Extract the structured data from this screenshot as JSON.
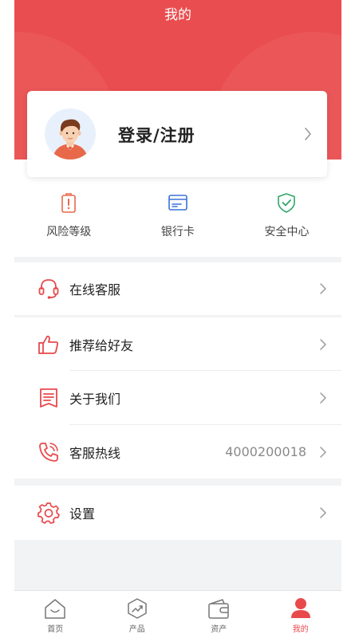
{
  "header": {
    "title": "我的"
  },
  "login": {
    "label": "登录/注册"
  },
  "quick_actions": [
    {
      "label": "风险等级",
      "icon": "risk-level-icon",
      "color": "#e8684a"
    },
    {
      "label": "银行卡",
      "icon": "bank-card-icon",
      "color": "#3a72d8"
    },
    {
      "label": "安全中心",
      "icon": "shield-icon",
      "color": "#2fa76a"
    }
  ],
  "menu": {
    "service": {
      "label": "在线客服",
      "icon": "headset-icon"
    },
    "recommend": {
      "label": "推荐给好友",
      "icon": "thumbs-up-icon"
    },
    "about": {
      "label": "关于我们",
      "icon": "document-icon"
    },
    "hotline": {
      "label": "客服热线",
      "value": "4000200018",
      "icon": "phone-icon"
    },
    "settings": {
      "label": "设置",
      "icon": "gear-icon"
    }
  },
  "tabbar": [
    {
      "label": "首页",
      "icon": "home-icon",
      "active": false
    },
    {
      "label": "产品",
      "icon": "product-icon",
      "active": false
    },
    {
      "label": "资产",
      "icon": "wallet-icon",
      "active": false
    },
    {
      "label": "我的",
      "icon": "user-icon",
      "active": true
    }
  ],
  "colors": {
    "brand": "#ea4d4f",
    "accent_red": "#e84a4c",
    "background": "#f2f3f5"
  }
}
